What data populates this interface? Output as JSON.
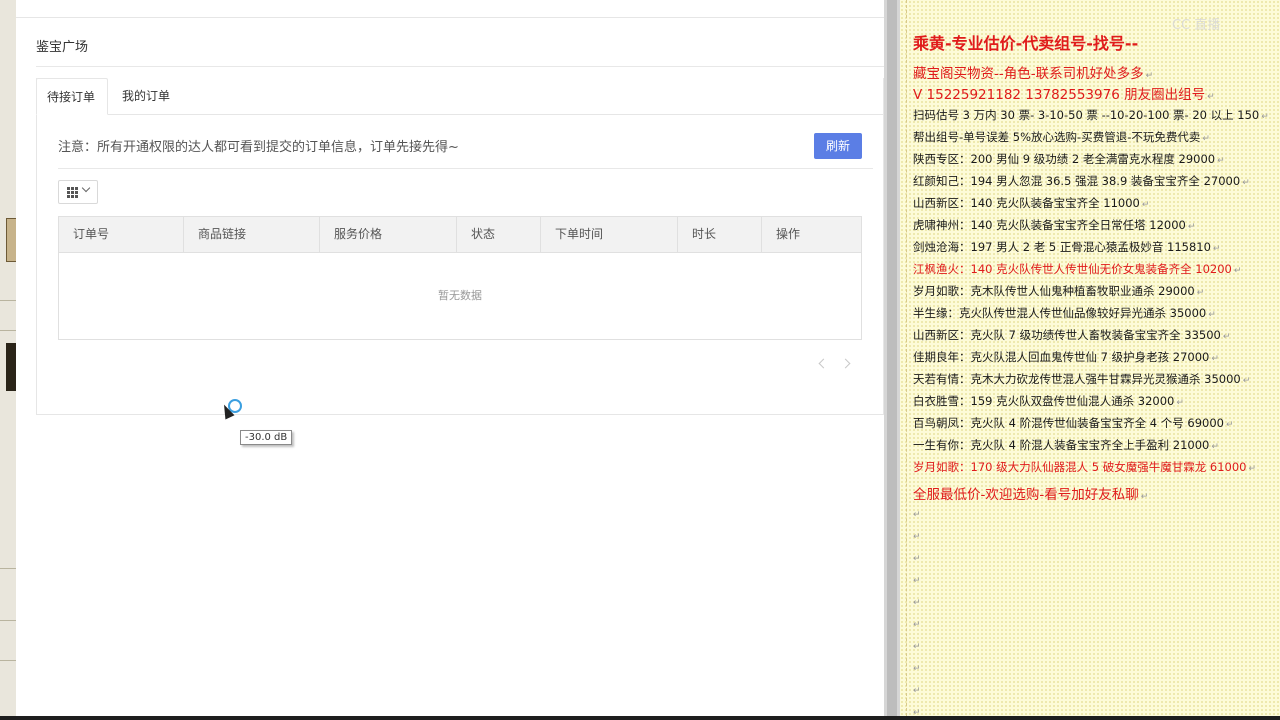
{
  "app": {
    "page_title": "鉴宝广场",
    "tabs": [
      {
        "label": "待接订单",
        "active": true
      },
      {
        "label": "我的订单",
        "active": false
      }
    ],
    "notice": "注意：所有开通权限的达人都可看到提交的订单信息，订单先接先得~",
    "refresh_label": "刷新",
    "table": {
      "columns": [
        "订单号",
        "商品链接",
        "服务价格",
        "状态",
        "下单时间",
        "时长",
        "操作"
      ],
      "empty_text": "暂无数据"
    },
    "accent_color": "#5b7ee5"
  },
  "tooltip": "-30.0 dB",
  "watermark": "CC 直播",
  "doc": {
    "lines": [
      {
        "text": "乘黄-专业估价-代卖组号-找号--",
        "style": "big red"
      },
      {
        "text": "藏宝阁买物资--角色-联系司机好处多多",
        "style": "mid red"
      },
      {
        "text": "V 15225921182        13782553976 朋友圈出组号",
        "style": "mid red"
      },
      {
        "text": "扫码估号 3 万内 30 票- 3-10-50 票  --10-20-100 票- 20 以上 150",
        "style": ""
      },
      {
        "text": "帮出组号-单号误差 5%放心选购-买费管退-不玩免费代卖",
        "style": ""
      },
      {
        "text": "陕西专区：200 男仙 9 级功绩 2 老全满雷克水程度 29000",
        "style": ""
      },
      {
        "text": "红颜知己：194 男人忽混 36.5 强混 38.9 装备宝宝齐全 27000",
        "style": ""
      },
      {
        "text": "山西新区：140 克火队装备宝宝齐全 11000",
        "style": ""
      },
      {
        "text": "虎啸神州：140 克火队装备宝宝齐全日常任塔 12000",
        "style": ""
      },
      {
        "text": "剑烛沧海：197 男人 2 老 5 正骨混心猿孟极妙音 115810",
        "style": ""
      },
      {
        "text": "江枫渔火：140 克火队传世人传世仙无价女鬼装备齐全 10200",
        "style": "red"
      },
      {
        "text": "岁月如歌：克木队传世人仙鬼种植畜牧职业通杀 29000",
        "style": ""
      },
      {
        "text": "半生缘：克火队传世混人传世仙品像较好异光通杀 35000",
        "style": ""
      },
      {
        "text": "山西新区：克火队 7 级功绩传世人畜牧装备宝宝齐全 33500",
        "style": ""
      },
      {
        "text": "佳期良年：克火队混人回血鬼传世仙 7 级护身老孩 27000",
        "style": ""
      },
      {
        "text": "天若有情：克木大力砍龙传世混人强牛甘霖异光灵猴通杀 35000",
        "style": ""
      },
      {
        "text": "白衣胜雪：159 克火队双盘传世仙混人通杀 32000",
        "style": ""
      },
      {
        "text": "百鸟朝凤：克火队 4 阶混传世仙装备宝宝齐全 4 个号 69000",
        "style": ""
      },
      {
        "text": "一生有你：克火队 4 阶混人装备宝宝齐全上手盈利 21000",
        "style": ""
      },
      {
        "text": "岁月如歌：170 级大力队仙器混人 5 破女魔强牛魔甘霖龙 61000",
        "style": "red"
      },
      {
        "text": "全服最低价-欢迎选购-看号加好友私聊",
        "style": "mid red"
      }
    ],
    "para_mark": "↵"
  }
}
